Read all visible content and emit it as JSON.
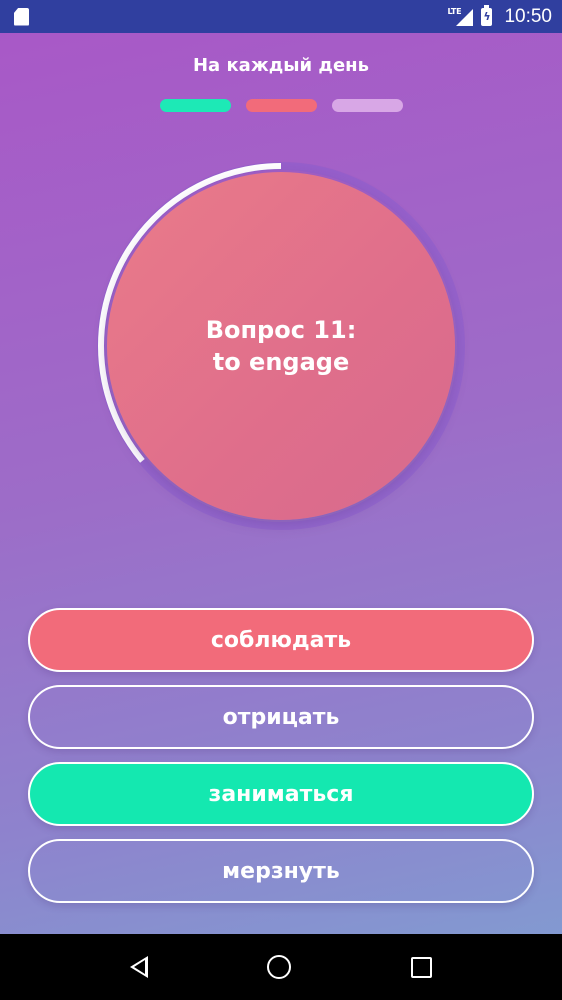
{
  "status_bar": {
    "network": "LTE",
    "time": "10:50",
    "icons": [
      "sd-card-icon",
      "lte-signal-icon",
      "battery-charging-icon"
    ]
  },
  "header": {
    "title": "На каждый день"
  },
  "progress": {
    "dots": [
      {
        "state": "correct",
        "color": "#1de9b6"
      },
      {
        "state": "wrong",
        "color": "#f26b7a"
      },
      {
        "state": "pending",
        "color": "#d8a7e6"
      }
    ]
  },
  "timer": {
    "remaining_fraction": 0.36
  },
  "question": {
    "label": "Вопрос 11:",
    "word": "to engage"
  },
  "answers": [
    {
      "label": "соблюдать",
      "state": "wrong",
      "fill": "#f26b7a"
    },
    {
      "label": "отрицать",
      "state": "neutral",
      "fill": "transparent"
    },
    {
      "label": "заниматься",
      "state": "correct",
      "fill": "#14e8b0"
    },
    {
      "label": "мерзнуть",
      "state": "neutral",
      "fill": "transparent"
    }
  ],
  "nav_bar": {
    "icons": [
      "back-icon",
      "home-icon",
      "recent-apps-icon"
    ]
  }
}
